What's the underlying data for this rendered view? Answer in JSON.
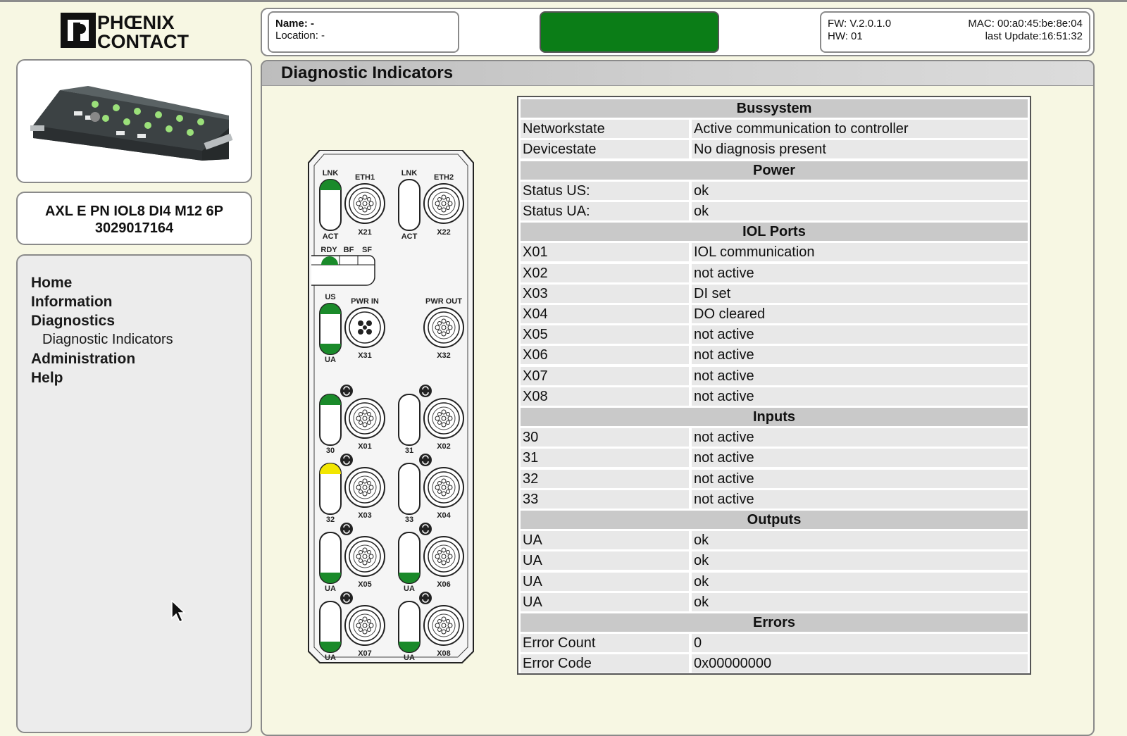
{
  "logo": {
    "line1": "PHŒNIX",
    "line2": "CONTACT"
  },
  "product": {
    "name": "AXL E PN IOL8 DI4 M12 6P",
    "number": "3029017164"
  },
  "nav": {
    "home": "Home",
    "information": "Information",
    "diagnostics": "Diagnostics",
    "diagnostic_indicators": "Diagnostic Indicators",
    "administration": "Administration",
    "help": "Help"
  },
  "header": {
    "name": "Name: -",
    "location": "Location: -",
    "status_color": "#0b7d17",
    "fw": "FW: V.2.0.1.0",
    "hw": "HW: 01",
    "mac": "MAC: 00:a0:45:be:8e:04",
    "last_update": "last Update:16:51:32"
  },
  "page_title": "Diagnostic Indicators",
  "device_labels": {
    "lnk1": "LNK",
    "eth1": "ETH1",
    "lnk2": "LNK",
    "eth2": "ETH2",
    "act1": "ACT",
    "x21": "X21",
    "act2": "ACT",
    "x22": "X22",
    "rdy": "RDY",
    "bf": "BF",
    "sf": "SF",
    "us": "US",
    "pwr_in": "PWR IN",
    "pwr_out": "PWR OUT",
    "ua": "UA",
    "x31": "X31",
    "x32": "X32",
    "p30": "30",
    "x01": "X01",
    "p31": "31",
    "x02": "X02",
    "p32": "32",
    "x03": "X03",
    "p33": "33",
    "x04": "X04",
    "ua5": "UA",
    "x05": "X05",
    "ua6": "UA",
    "x06": "X06",
    "ua7": "UA",
    "x07": "X07",
    "ua8": "UA",
    "x08": "X08"
  },
  "sections": [
    {
      "title": "Bussystem",
      "rows": [
        [
          "Networkstate",
          "Active communication to controller"
        ],
        [
          "Devicestate",
          "No diagnosis present"
        ]
      ]
    },
    {
      "title": "Power",
      "rows": [
        [
          "Status US:",
          "ok"
        ],
        [
          "Status UA:",
          "ok"
        ]
      ]
    },
    {
      "title": "IOL Ports",
      "rows": [
        [
          "X01",
          "IOL communication"
        ],
        [
          "X02",
          "not active"
        ],
        [
          "X03",
          "DI set"
        ],
        [
          "X04",
          "DO cleared"
        ],
        [
          "X05",
          "not active"
        ],
        [
          "X06",
          "not active"
        ],
        [
          "X07",
          "not active"
        ],
        [
          "X08",
          "not active"
        ]
      ]
    },
    {
      "title": "Inputs",
      "rows": [
        [
          "30",
          "not active"
        ],
        [
          "31",
          "not active"
        ],
        [
          "32",
          "not active"
        ],
        [
          "33",
          "not active"
        ]
      ]
    },
    {
      "title": "Outputs",
      "rows": [
        [
          "UA",
          "ok"
        ],
        [
          "UA",
          "ok"
        ],
        [
          "UA",
          "ok"
        ],
        [
          "UA",
          "ok"
        ]
      ]
    },
    {
      "title": "Errors",
      "rows": [
        [
          "Error Count",
          "0"
        ],
        [
          "Error Code",
          "0x00000000"
        ]
      ]
    }
  ],
  "colors": {
    "led_green": "#1a8a2a",
    "led_yellow": "#f2e600"
  }
}
